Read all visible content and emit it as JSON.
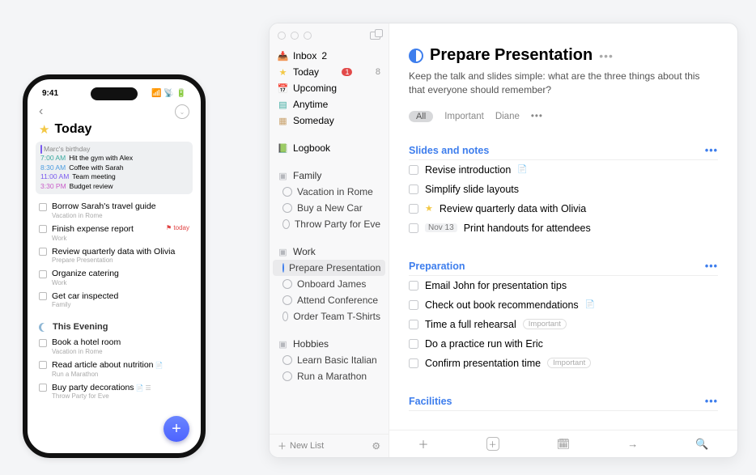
{
  "phone": {
    "status_time": "9:41",
    "header_title": "Today",
    "agenda": {
      "birthday": "Marc's birthday",
      "rows": [
        {
          "time": "7:00 AM",
          "color": "#3aa99f",
          "label": "Hit the gym with Alex"
        },
        {
          "time": "8:30 AM",
          "color": "#4d9de0",
          "label": "Coffee with Sarah"
        },
        {
          "time": "11:00 AM",
          "color": "#7a5aef",
          "label": "Team meeting"
        },
        {
          "time": "3:30 PM",
          "color": "#c95dc9",
          "label": "Budget review"
        }
      ]
    },
    "tasks": [
      {
        "title": "Borrow Sarah's travel guide",
        "sub": "Vacation in Rome"
      },
      {
        "title": "Finish expense report",
        "sub": "Work",
        "badge": "today"
      },
      {
        "title": "Review quarterly data with Olivia",
        "sub": "Prepare Presentation"
      },
      {
        "title": "Organize catering",
        "sub": "Work"
      },
      {
        "title": "Get car inspected",
        "sub": "Family"
      }
    ],
    "evening_header": "This Evening",
    "evening": [
      {
        "title": "Book a hotel room",
        "sub": "Vacation in Rome"
      },
      {
        "title": "Read article about nutrition",
        "sub": "Run a Marathon",
        "note": true
      },
      {
        "title": "Buy party decorations",
        "sub": "Throw Party for Eve",
        "note": true,
        "list": true
      }
    ]
  },
  "mac": {
    "sidebar": {
      "top": [
        {
          "icon": "inbox",
          "label": "Inbox",
          "count": "2"
        },
        {
          "icon": "star",
          "label": "Today",
          "badge": "1",
          "count": "8"
        },
        {
          "icon": "cal",
          "label": "Upcoming"
        },
        {
          "icon": "any",
          "label": "Anytime"
        },
        {
          "icon": "some",
          "label": "Someday"
        }
      ],
      "logbook": "Logbook",
      "areas": [
        {
          "name": "Family",
          "projects": [
            "Vacation in Rome",
            "Buy a New Car",
            "Throw Party for Eve"
          ]
        },
        {
          "name": "Work",
          "projects": [
            "Prepare Presentation",
            "Onboard James",
            "Attend Conference",
            "Order Team T-Shirts"
          ],
          "selected": 0,
          "half": 0
        },
        {
          "name": "Hobbies",
          "projects": [
            "Learn Basic Italian",
            "Run a Marathon"
          ]
        }
      ],
      "new_list": "New List"
    },
    "main": {
      "title": "Prepare Presentation",
      "description": "Keep the talk and slides simple: what are the three things about this that everyone should remember?",
      "tags": {
        "all": "All",
        "t1": "Important",
        "t2": "Diane"
      },
      "sections": [
        {
          "heading": "Slides and notes",
          "tasks": [
            {
              "label": "Revise introduction",
              "note": true
            },
            {
              "label": "Simplify slide layouts"
            },
            {
              "label": "Review quarterly data with Olivia",
              "star": true
            },
            {
              "label": "Print handouts for attendees",
              "date": "Nov 13"
            }
          ]
        },
        {
          "heading": "Preparation",
          "tasks": [
            {
              "label": "Email John for presentation tips"
            },
            {
              "label": "Check out book recommendations",
              "note": true
            },
            {
              "label": "Time a full rehearsal",
              "tag": "Important"
            },
            {
              "label": "Do a practice run with Eric"
            },
            {
              "label": "Confirm presentation time",
              "tag": "Important"
            }
          ]
        },
        {
          "heading": "Facilities",
          "tasks": []
        }
      ]
    }
  }
}
